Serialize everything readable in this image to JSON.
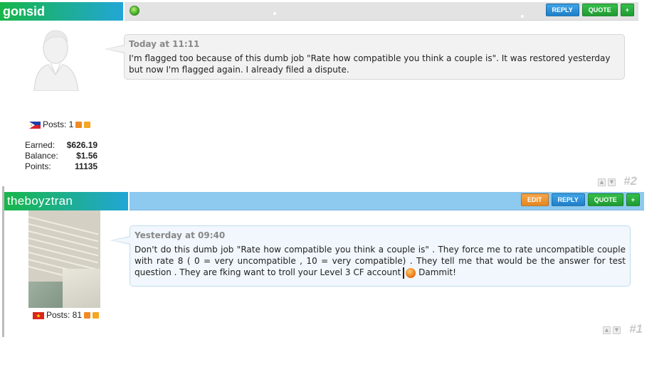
{
  "posts": [
    {
      "username": "gonsid",
      "time": "Today at 11:11",
      "message": "I'm flagged too because of this dumb job \"Rate how compatible you think a couple is\". It was restored yesterday but now I'm flagged again. I already filed a dispute.",
      "posts_label": "Posts: 1",
      "stats": [
        {
          "label": "Earned:",
          "value": "$626.19"
        },
        {
          "label": "Balance:",
          "value": "$1.56"
        },
        {
          "label": "Points:",
          "value": "11135"
        }
      ],
      "buttons": {
        "reply": "REPLY",
        "quote": "QUOTE",
        "plus": "+"
      },
      "post_number": "#2",
      "flag": "philippines-flag"
    },
    {
      "username": "theboyztran",
      "time": "Yesterday at 09:40",
      "message_part1": "Don't do this dumb job \"Rate how compatible you think a couple is\" . They force me to rate uncompatible couple with rate 8 ( 0 = very uncompatible , 10 = very compatible) . They tell me that would be the answer for test question . They are fking want to troll your Level 3 CF account",
      "message_part2": "Dammit!",
      "posts_label": "Posts: 81",
      "buttons": {
        "edit": "EDIT",
        "reply": "REPLY",
        "quote": "QUOTE",
        "plus": "+"
      },
      "post_number": "#1",
      "flag": "vietnam-flag"
    }
  ],
  "colors": {
    "userbar_green": "#18b64a",
    "userbar_blue": "#22a6d6",
    "reply_blue": "#1e7fc9",
    "quote_green": "#1f9a31",
    "edit_orange": "#e6871f"
  }
}
